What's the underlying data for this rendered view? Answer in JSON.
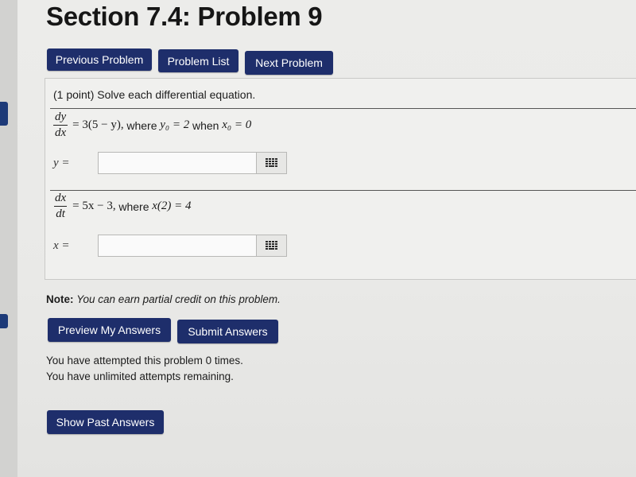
{
  "page": {
    "title": "Section 7.4: Problem 9"
  },
  "nav": {
    "previous_label": "Previous Problem",
    "list_label": "Problem List",
    "next_label": "Next Problem"
  },
  "problem": {
    "header": "(1 point) Solve each differential equation.",
    "part1": {
      "frac_num": "dy",
      "frac_den": "dx",
      "equation_rest": "= 3(5 − y),",
      "where_text": "where",
      "condition_a": "y₀ = 2",
      "when_text": "when",
      "condition_b": "x₀ = 0",
      "answer_label": "y =",
      "answer_value": ""
    },
    "part2": {
      "frac_num": "dx",
      "frac_den": "dt",
      "equation_rest": "= 5x − 3,",
      "where_text": "where",
      "condition": "x(2) = 4",
      "answer_label": "x =",
      "answer_value": ""
    }
  },
  "note": {
    "bold": "Note:",
    "text": "You can earn partial credit on this problem."
  },
  "actions": {
    "preview_label": "Preview My Answers",
    "submit_label": "Submit Answers",
    "past_label": "Show Past Answers"
  },
  "attempts": {
    "line1": "You have attempted this problem 0 times.",
    "line2": "You have unlimited attempts remaining."
  },
  "colors": {
    "button_bg": "#1e2e6b",
    "button_text": "#ffffff",
    "page_bg": "#ececea"
  },
  "icons": {
    "math_editor": "keypad-grid-icon"
  }
}
